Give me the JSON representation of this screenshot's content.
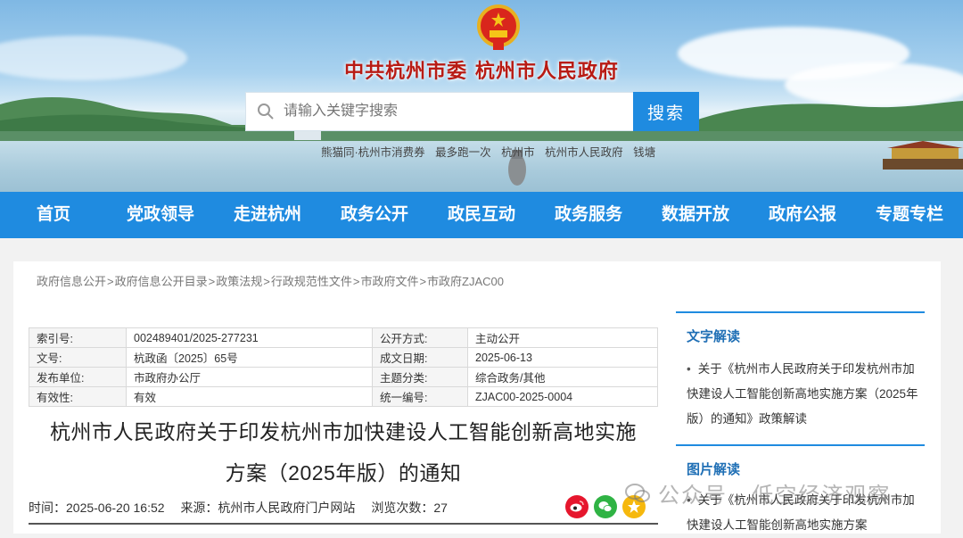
{
  "header": {
    "site_title": "中共杭州市委   杭州市人民政府",
    "search": {
      "placeholder": "请输入关键字搜索",
      "button_label": "搜索"
    },
    "hot_links": [
      "熊猫同·杭州市消费券",
      "最多跑一次",
      "杭州市",
      "杭州市人民政府",
      "钱塘"
    ]
  },
  "nav": [
    "首页",
    "党政领导",
    "走进杭州",
    "政务公开",
    "政民互动",
    "政务服务",
    "数据开放",
    "政府公报",
    "专题专栏"
  ],
  "breadcrumb": [
    "政府信息公开",
    "政府信息公开目录",
    "政策法规",
    "行政规范性文件",
    "市政府文件",
    "市政府ZJAC00"
  ],
  "breadcrumb_sep": ">",
  "meta": {
    "rows": [
      [
        {
          "k": "索引号:",
          "v": "002489401/2025-277231"
        },
        {
          "k": "公开方式:",
          "v": "主动公开"
        }
      ],
      [
        {
          "k": "文号:",
          "v": "杭政函〔2025〕65号"
        },
        {
          "k": "成文日期:",
          "v": "2025-06-13"
        }
      ],
      [
        {
          "k": "发布单位:",
          "v": "市政府办公厅"
        },
        {
          "k": "主题分类:",
          "v": "综合政务/其他"
        }
      ],
      [
        {
          "k": "有效性:",
          "v": "有效"
        },
        {
          "k": "统一编号:",
          "v": "ZJAC00-2025-0004"
        }
      ]
    ]
  },
  "document": {
    "title": "杭州市人民政府关于印发杭州市加快建设人工智能创新高地实施方案（2025年版）的通知",
    "time": "时间：2025-06-20 16:52",
    "source": "来源：杭州市人民政府门户网站",
    "views": "浏览次数：27"
  },
  "sidebar": {
    "text_interpretation": {
      "title": "文字解读",
      "items": [
        "关于《杭州市人民政府关于印发杭州市加快建设人工智能创新高地实施方案（2025年版）的通知》政策解读"
      ]
    },
    "image_interpretation": {
      "title": "图片解读",
      "items": [
        "关于《杭州市人民政府关于印发杭州市加快建设人工智能创新高地实施方案"
      ]
    }
  },
  "watermark": "公众号 · 低空经济观察",
  "colors": {
    "brand_blue": "#1f8be0",
    "title_red": "#b81b14"
  },
  "icons": [
    "national-emblem-icon",
    "search-icon",
    "weibo-icon",
    "wechat-icon",
    "qzone-icon",
    "wechat-official-account-icon"
  ]
}
